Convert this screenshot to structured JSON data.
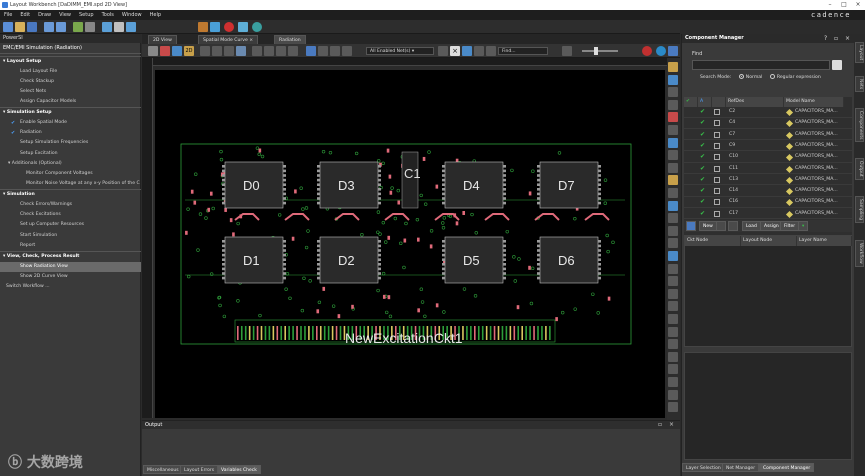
{
  "window": {
    "title": "Layout Workbench [DaDIMM_EMI.spd 2D View]"
  },
  "menu": [
    "File",
    "Edit",
    "Draw",
    "View",
    "Setup",
    "Tools",
    "Window",
    "Help"
  ],
  "brand": "cadence",
  "workflow_panel": {
    "title": "PowerSI",
    "subtitle": "EMC/EMI Simulation (Radiation)",
    "rows": [
      {
        "label": "Layout Setup",
        "kind": "section"
      },
      {
        "label": "Load Layout File",
        "kind": "item"
      },
      {
        "label": "Check Stackup",
        "kind": "item"
      },
      {
        "label": "Select Nets",
        "kind": "item"
      },
      {
        "label": "Assign Capacitor Models",
        "kind": "item"
      },
      {
        "label": "Simulation Setup",
        "kind": "section"
      },
      {
        "label": "Enable Spatial Mode",
        "kind": "checked"
      },
      {
        "label": "Radiation",
        "kind": "checked"
      },
      {
        "label": "Setup Simulation Frequencies",
        "kind": "item"
      },
      {
        "label": "Setup Excitation",
        "kind": "item"
      },
      {
        "label": "Additionals (Optional)",
        "kind": "subsection"
      },
      {
        "label": "Monitor Component Voltages",
        "kind": "subitem"
      },
      {
        "label": "Monitor Noise Voltage at any x-y Position of the C",
        "kind": "subitem"
      },
      {
        "label": "Simulation",
        "kind": "section"
      },
      {
        "label": "Check Errors/Warnings",
        "kind": "item"
      },
      {
        "label": "Check Excitations",
        "kind": "item"
      },
      {
        "label": "Set up Computer Resources",
        "kind": "item"
      },
      {
        "label": "Start Simulation",
        "kind": "item"
      },
      {
        "label": "Report",
        "kind": "item"
      },
      {
        "label": "View, Check, Process Result",
        "kind": "section"
      },
      {
        "label": "Show Radiation View",
        "kind": "selected"
      },
      {
        "label": "Show 2D Curve View",
        "kind": "item"
      },
      {
        "label": "Switch Workflow ...",
        "kind": "root"
      }
    ]
  },
  "doc_tabs": [
    "2D View",
    "Spatial Mode Curve",
    "Radiation"
  ],
  "toolbar2": {
    "net_filter": "All Enabled Net(s)",
    "find_placeholder": "Find..."
  },
  "board": {
    "chips": [
      "D0",
      "D3",
      "D4",
      "D7",
      "D1",
      "D2",
      "D5",
      "D6"
    ],
    "connector_label": "C1",
    "net_label": "NewExcitationCkt1"
  },
  "output": {
    "title": "Output",
    "tabs": [
      "Miscellaneous",
      "Layout Errors",
      "Variables Check"
    ]
  },
  "component_manager": {
    "title": "Component Manager",
    "find_label": "Find",
    "search_mode_label": "Search Mode:",
    "mode_normal": "Normal",
    "mode_regex": "Regular expression",
    "columns": [
      "RefDes",
      "Model Name"
    ],
    "rows": [
      {
        "ref": "C2",
        "model": "CAPACITORS_MA..."
      },
      {
        "ref": "C4",
        "model": "CAPACITORS_MA..."
      },
      {
        "ref": "C7",
        "model": "CAPACITORS_MA..."
      },
      {
        "ref": "C9",
        "model": "CAPACITORS_MA..."
      },
      {
        "ref": "C10",
        "model": "CAPACITORS_MA..."
      },
      {
        "ref": "C11",
        "model": "CAPACITORS_MA..."
      },
      {
        "ref": "C13",
        "model": "CAPACITORS_MA..."
      },
      {
        "ref": "C14",
        "model": "CAPACITORS_MA..."
      },
      {
        "ref": "C16",
        "model": "CAPACITORS_MA..."
      },
      {
        "ref": "C17",
        "model": "CAPACITORS_MA..."
      }
    ],
    "buttons": [
      "New",
      "Load",
      "Assign",
      "Filter"
    ],
    "node_columns": [
      "Ckt Node",
      "Layout Node",
      "Layer Name"
    ],
    "bottom_tabs": [
      "Layer Selection",
      "Net Manager",
      "Component Manager"
    ]
  },
  "side_tabs": [
    "Layout",
    "Nets",
    "Components",
    "Output",
    "Sampling",
    "Workflow"
  ],
  "watermark": "大数跨境",
  "colors": {
    "ok": "#39c14a",
    "board_trace": "#2e9e3a",
    "pad": "#e06a7a",
    "accent": "#4ea3ff"
  }
}
